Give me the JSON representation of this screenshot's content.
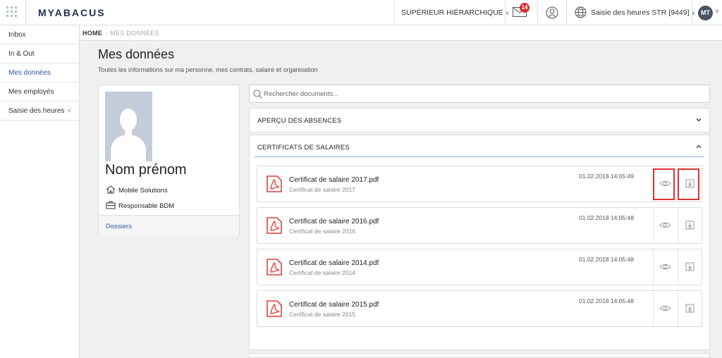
{
  "app": {
    "brand": "MYABACUS",
    "superior_label": "SUPÉRIEUR HIÉRARCHIQUE",
    "mail_badge": "14",
    "time_entry_label": "Saisie des heures STR [9449]",
    "avatar_initials": "MT"
  },
  "sidebar": {
    "items": [
      {
        "label": "Inbox"
      },
      {
        "label": "In & Out"
      },
      {
        "label": "Mes données"
      },
      {
        "label": "Mes employés"
      },
      {
        "label": "Saisie des heures"
      }
    ],
    "active_index": 2
  },
  "breadcrumb": {
    "home": "HOME",
    "separator": "›",
    "current": "MES DONNÉES"
  },
  "page": {
    "title": "Mes données",
    "subtitle": "Toutes les informations sur ma personne, mes contrats, salaire et organisation"
  },
  "profile": {
    "name": "Nom prénom",
    "company": "Mobile Solutions",
    "role": "Responsable BDM",
    "link": "Dossiers"
  },
  "search": {
    "placeholder": "Rechercher documents..."
  },
  "panels": {
    "absences": {
      "label": "APERÇU DES ABSENCES"
    },
    "certificates": {
      "label": "CERTIFICATS DE SALAIRES"
    }
  },
  "documents": [
    {
      "file": "Certificat de salaire 2017.pdf",
      "subtitle": "Certificat de salaire 2017",
      "date": "01.02.2018 14:05:49"
    },
    {
      "file": "Certificat de salaire 2016.pdf",
      "subtitle": "Certificat de salaire 2016",
      "date": "01.02.2018 14:05:48"
    },
    {
      "file": "Certificat de salaire 2014.pdf",
      "subtitle": "Certificat de salaire 2014",
      "date": "01.02.2018 14:05:48"
    },
    {
      "file": "Certificat de salaire 2015.pdf",
      "subtitle": "Certificat de salaire 2015",
      "date": "01.02.2018 14:05:48"
    }
  ],
  "colors": {
    "brand": "#1f2d54",
    "link": "#2c5aa0",
    "pdf_red": "#e0403a",
    "highlight": "#e03030",
    "badge": "#d9302c"
  }
}
